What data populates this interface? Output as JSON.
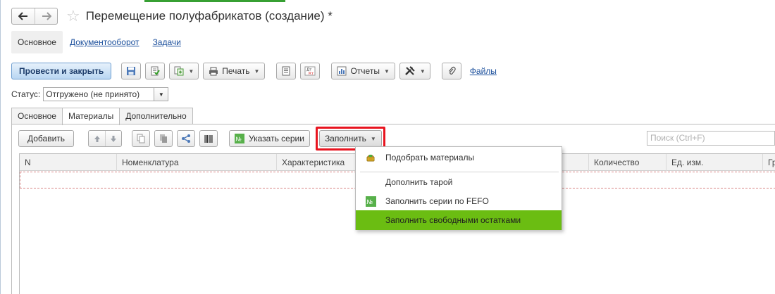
{
  "window": {
    "title": "Перемещение полуфабрикатов (создание) *"
  },
  "section_tabs": [
    {
      "label": "Основное"
    },
    {
      "label": "Документооборот"
    },
    {
      "label": "Задачи"
    }
  ],
  "toolbar": {
    "post_close_label": "Провести и закрыть",
    "print_label": "Печать",
    "reports_label": "Отчеты",
    "files_label": "Файлы"
  },
  "status": {
    "label": "Статус:",
    "value": "Отгружено (не принято)"
  },
  "form_tabs": [
    {
      "label": "Основное"
    },
    {
      "label": "Материалы"
    },
    {
      "label": "Дополнительно"
    }
  ],
  "inner_toolbar": {
    "add_label": "Добавить",
    "series_label": "Указать серии",
    "fill_label": "Заполнить",
    "search_placeholder": "Поиск (Ctrl+F)"
  },
  "table": {
    "columns": [
      "N",
      "Номенклатура",
      "Характеристика",
      "Количество",
      "Ед. изм.",
      "Гр"
    ]
  },
  "fill_menu": {
    "items": [
      {
        "label": "Подобрать материалы",
        "icon": "basket-icon"
      },
      {
        "label": "Дополнить тарой",
        "icon": ""
      },
      {
        "label": "Заполнить серии по FEFO",
        "icon": "series-number-icon"
      },
      {
        "label": "Заполнить свободными остатками",
        "icon": "",
        "selected": true
      }
    ]
  },
  "colors": {
    "accent_green": "#6bbd12",
    "highlight_red": "#e8141f",
    "link_blue": "#1b4f9c"
  }
}
